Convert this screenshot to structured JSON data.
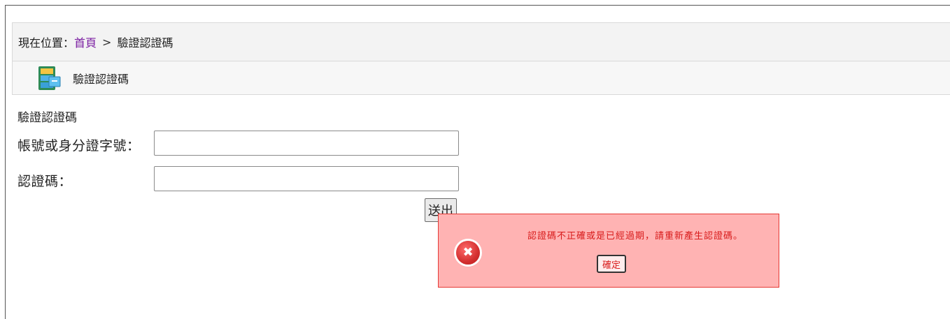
{
  "breadcrumb": {
    "prefix": "現在位置：",
    "home": "首頁",
    "separator": ">",
    "current": "驗證認證碼"
  },
  "titlebar": {
    "icon": "file-cabinet-icon",
    "title": "驗證認證碼"
  },
  "form": {
    "heading": "驗證認證碼",
    "account_label": "帳號或身分證字號：",
    "account_value": "",
    "code_label": "認證碼：",
    "code_value": "",
    "submit_label": "送出"
  },
  "alert": {
    "icon": "error-icon",
    "message": "認證碼不正確或是已經過期，請重新產生認證碼。",
    "ok_label": "確定",
    "colors": {
      "background": "#ffb3b3",
      "border": "#e53935",
      "text": "#d81b1b"
    }
  }
}
